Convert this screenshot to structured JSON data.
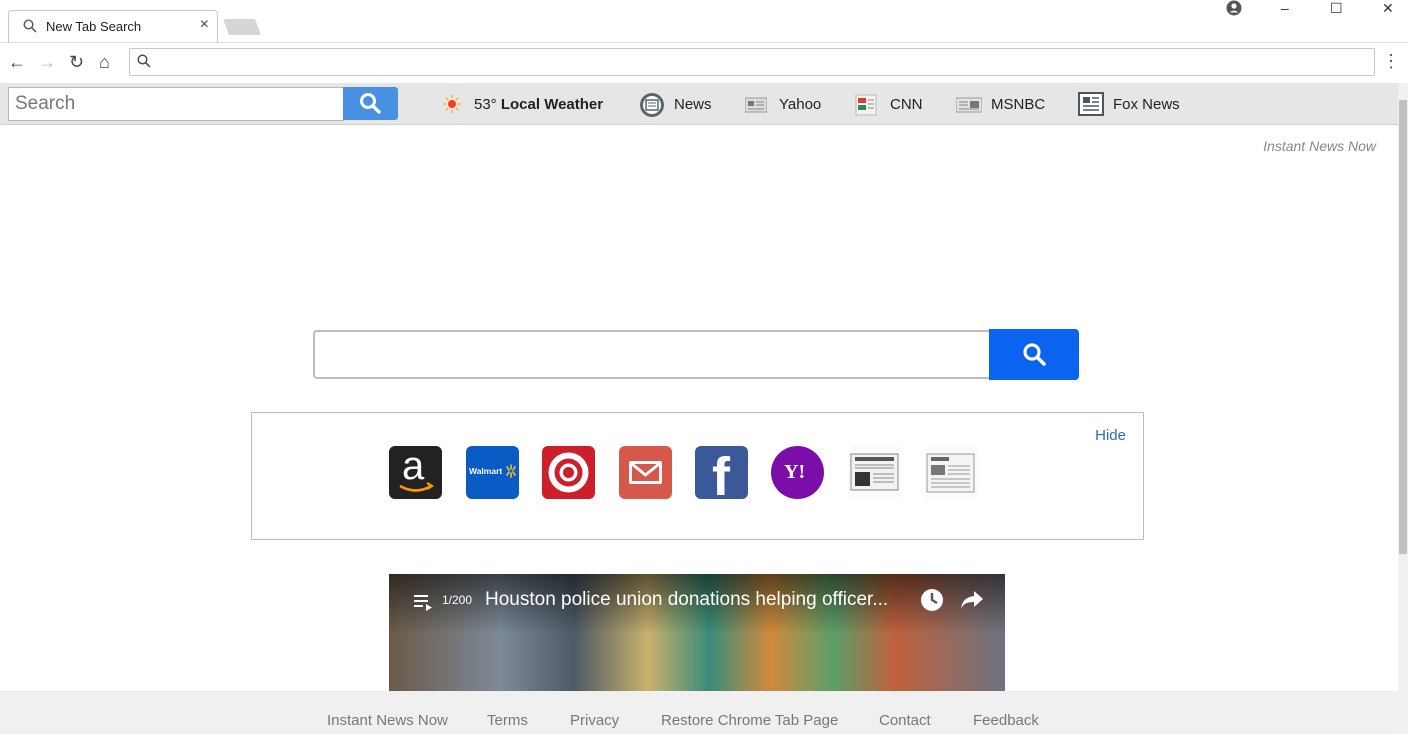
{
  "browser": {
    "tab_title": "New Tab Search",
    "tab_close": "×",
    "window_controls": {
      "minimize": "–",
      "maximize": "☐",
      "close": "✕"
    },
    "omnibox_value": "",
    "nav": {
      "back": "←",
      "forward": "→",
      "reload": "↻",
      "home": "⌂"
    },
    "menu": "⋮"
  },
  "extension_bar": {
    "search_placeholder": "Search",
    "weather_temp": "53°",
    "weather_label": "Local Weather",
    "links": [
      "News",
      "Yahoo",
      "CNN",
      "MSNBC",
      "Fox News"
    ],
    "accent_color": "#4a90e2"
  },
  "page": {
    "brand": "Instant News Now",
    "main_search_value": "",
    "hide_label": "Hide",
    "shortcuts": [
      {
        "name": "amazon",
        "label": "a"
      },
      {
        "name": "walmart",
        "label": "Walmart"
      },
      {
        "name": "target",
        "label": ""
      },
      {
        "name": "gmail",
        "label": ""
      },
      {
        "name": "facebook",
        "label": "f"
      },
      {
        "name": "yahoo",
        "label": "Y!"
      },
      {
        "name": "newspaper-1",
        "label": ""
      },
      {
        "name": "newspaper-2",
        "label": ""
      }
    ],
    "video": {
      "count": "1/200",
      "title": "Houston police union donations helping officer..."
    }
  },
  "footer": {
    "links": [
      "Instant News Now",
      "Terms",
      "Privacy",
      "Restore Chrome Tab Page",
      "Contact",
      "Feedback"
    ]
  }
}
